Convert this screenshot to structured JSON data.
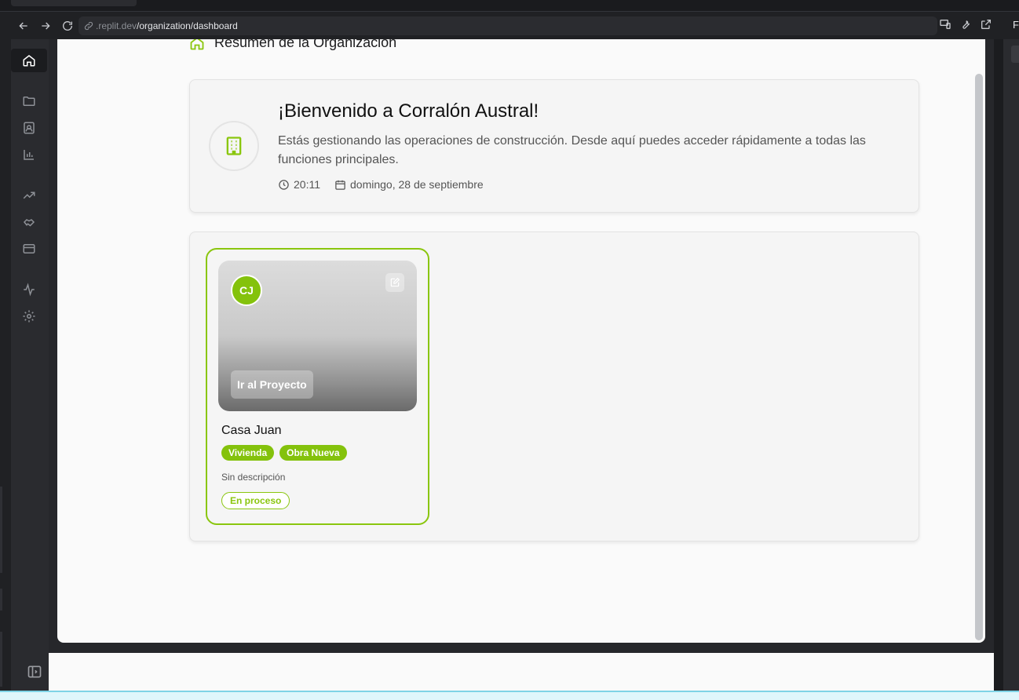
{
  "browser": {
    "url_host": ".replit.dev",
    "url_path": "/organization/dashboard",
    "edge_letter": "F"
  },
  "section": {
    "title": "Resumen de la Organización"
  },
  "welcome": {
    "title": "¡Bienvenido a Corralón Austral!",
    "description": "Estás gestionando las operaciones de construcción. Desde aquí puedes acceder rápidamente a todas las funciones principales.",
    "time": "20:11",
    "date": "domingo, 28 de septiembre"
  },
  "project": {
    "initials": "CJ",
    "go_label": "Ir al Proyecto",
    "name": "Casa Juan",
    "tags": [
      "Vivienda",
      "Obra Nueva"
    ],
    "description": "Sin descripción",
    "status": "En proceso"
  },
  "colors": {
    "accent": "#84c20c",
    "background": "#fafafa"
  }
}
